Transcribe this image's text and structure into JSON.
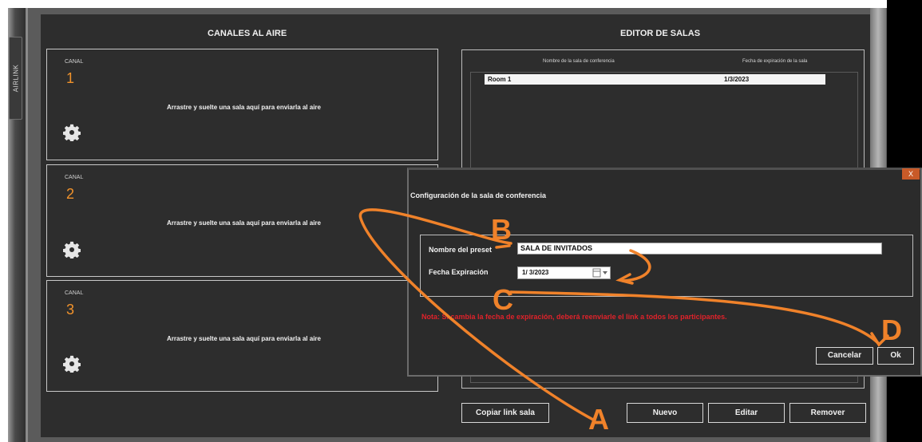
{
  "sidebar": {
    "tab_label": "AIRLINK"
  },
  "canales": {
    "title": "CANALES AL AIRE",
    "items": [
      {
        "label": "CANAL",
        "number": "1",
        "message": "Arrastre y suelte una sala aquí para enviarla al aire",
        "icon": "gear-icon"
      },
      {
        "label": "CANAL",
        "number": "2",
        "message": "Arrastre y suelte una sala aquí para enviarla al aire",
        "icon": "gear-icon"
      },
      {
        "label": "CANAL",
        "number": "3",
        "message": "Arrastre y suelte una sala aquí para enviarla al aire",
        "icon": "gear-icon"
      }
    ]
  },
  "editor": {
    "title": "EDITOR DE SALAS",
    "columns": [
      "Nombre de la sala de conferencia",
      "Fecha de expiración de la sala"
    ],
    "rows": [
      {
        "name": "Room 1",
        "expiry": "1/3/2023"
      }
    ],
    "buttons": {
      "copy": "Copiar link sala",
      "new": "Nuevo",
      "edit": "Editar",
      "remove": "Remover"
    }
  },
  "dialog": {
    "close": "X",
    "title": "Configuración de la sala de conferencia",
    "name_label": "Nombre del preset",
    "name_value": "SALA DE INVITADOS",
    "date_label": "Fecha Expiración",
    "date_value": "1/  3/2023",
    "note": "Nota: Si cambia la fecha de expiración, deberá reenviarle el link a todos los participantes.",
    "cancel": "Cancelar",
    "ok": "Ok"
  },
  "annotations": {
    "a": "A",
    "b": "B",
    "c": "C",
    "d": "D",
    "color": "#f0822a"
  },
  "colors": {
    "accent": "#f0922b",
    "background": "#2d2d2d",
    "warning": "#e0222a"
  }
}
